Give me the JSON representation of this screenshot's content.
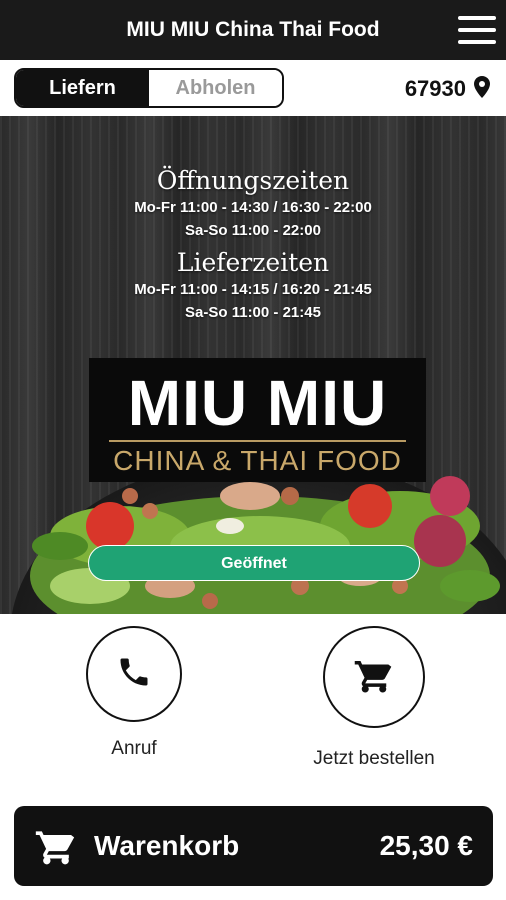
{
  "header": {
    "title": "MIU MIU China Thai Food",
    "menu_icon": "hamburger-menu-icon"
  },
  "mode": {
    "options": [
      "Liefern",
      "Abholen"
    ],
    "selected": "Liefern"
  },
  "location": {
    "zip": "67930",
    "icon": "location-pin-icon"
  },
  "hours": {
    "opening_title": "Öffnungszeiten",
    "opening_lines": [
      "Mo-Fr 11:00 - 14:30 / 16:30 - 22:00",
      "Sa-So 11:00 - 22:00"
    ],
    "delivery_title": "Lieferzeiten",
    "delivery_lines": [
      "Mo-Fr 11:00 - 14:15 / 16:20 - 21:45",
      "Sa-So 11:00 - 21:45"
    ]
  },
  "logo": {
    "line1": "MIU MIU",
    "line2": "CHINA & THAI FOOD"
  },
  "status": {
    "label": "Geöffnet",
    "color": "#1fa374"
  },
  "actions": {
    "call_label": "Anruf",
    "call_icon": "phone-icon",
    "order_label": "Jetzt bestellen",
    "order_icon": "cart-icon"
  },
  "cart": {
    "label": "Warenkorb",
    "total": "25,30 €",
    "icon": "cart-icon"
  }
}
